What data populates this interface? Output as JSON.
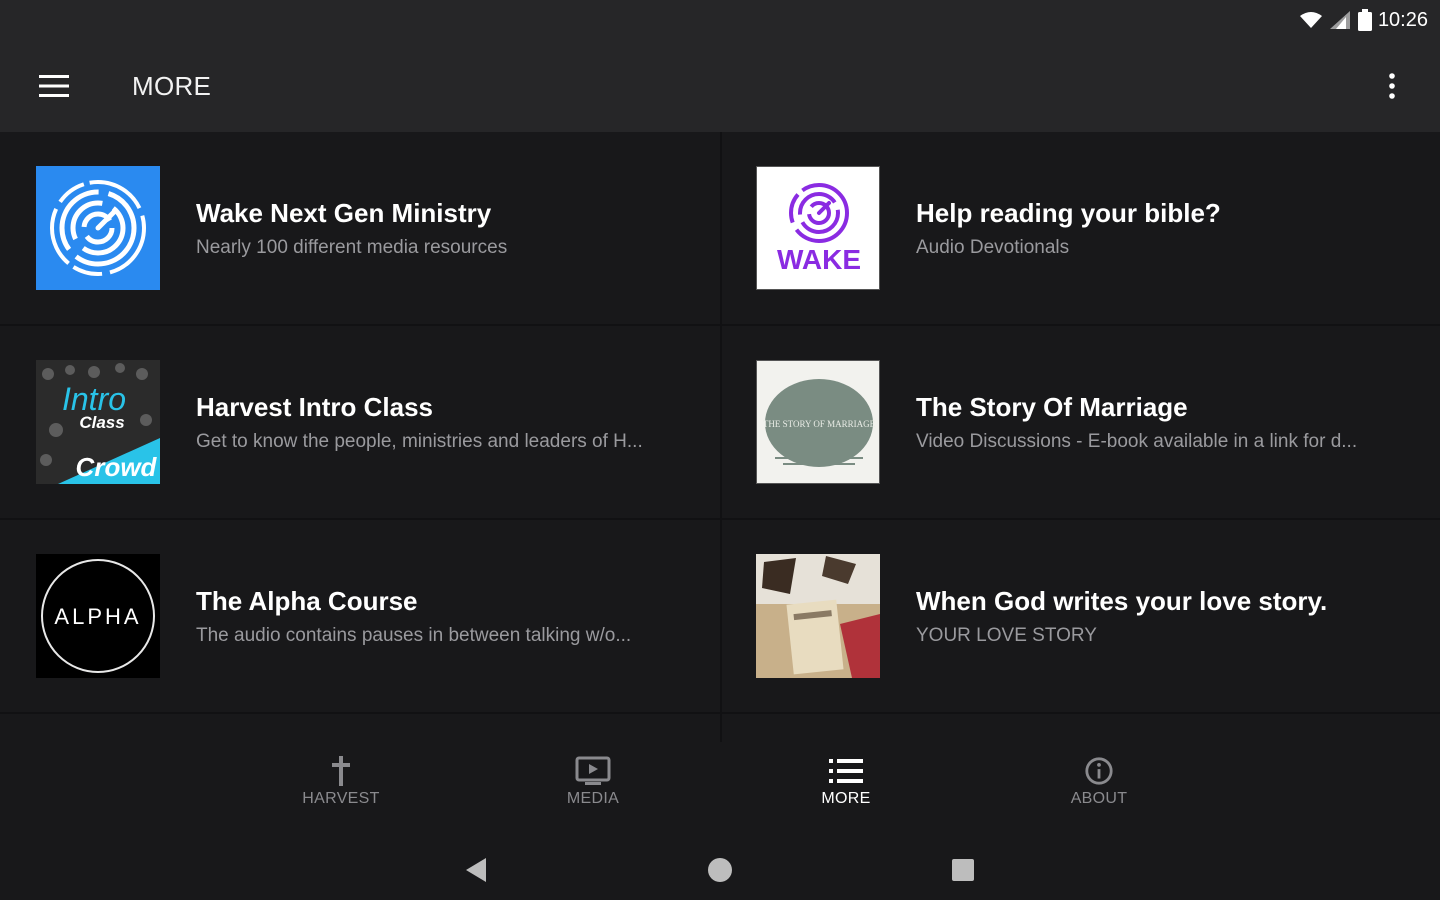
{
  "status_bar": {
    "time": "10:26"
  },
  "app_bar": {
    "title": "MORE"
  },
  "cards": [
    {
      "title": "Wake Next Gen Ministry",
      "subtitle": "Nearly 100 different media resources"
    },
    {
      "title": "Help reading your bible?",
      "subtitle": "Audio Devotionals",
      "thumb_text": "WAKE"
    },
    {
      "title": "Harvest Intro Class",
      "subtitle": "Get to know the people, ministries and leaders of H...",
      "thumb_text": [
        "Intro",
        "Class",
        "Crowd"
      ]
    },
    {
      "title": "The Story Of Marriage",
      "subtitle": "Video Discussions - E-book available in a link for d...",
      "thumb_text": "THE STORY OF MARRIAGE"
    },
    {
      "title": "The Alpha Course",
      "subtitle": "The audio contains  pauses in between talking w/o...",
      "thumb_text": "ALPHA"
    },
    {
      "title": "When God writes your love story.",
      "subtitle": "YOUR LOVE STORY"
    }
  ],
  "bottom_nav": [
    {
      "label": "HARVEST",
      "icon": "cross-icon"
    },
    {
      "label": "MEDIA",
      "icon": "tv-play-icon"
    },
    {
      "label": "MORE",
      "icon": "list-icon",
      "active": true
    },
    {
      "label": "ABOUT",
      "icon": "info-icon"
    }
  ],
  "colors": {
    "app_bar": "#262628",
    "background": "#18181a",
    "wake_blue": "#2a8af0",
    "wake_purple": "#8a2be2",
    "crowd_cyan": "#29c3e8"
  }
}
